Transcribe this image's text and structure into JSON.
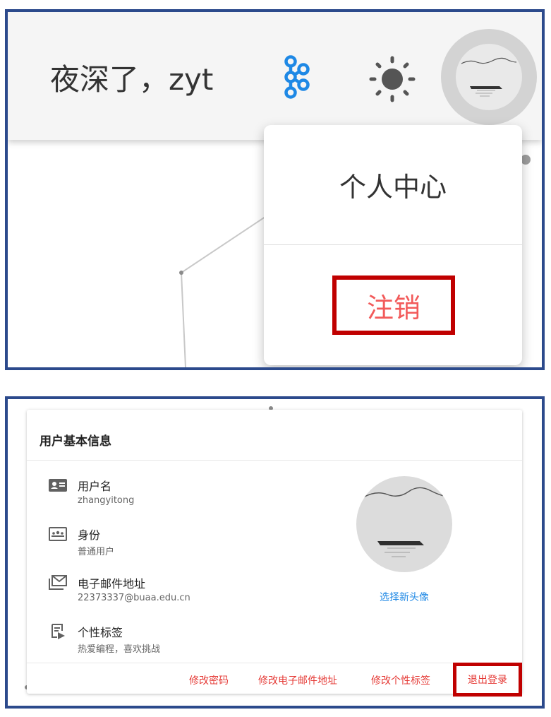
{
  "top": {
    "greeting": "夜深了，zyt",
    "icons": {
      "kafka": "kafka-icon",
      "theme": "sun-icon",
      "avatar": "avatar"
    },
    "menu": {
      "items": [
        {
          "label": "个人中心"
        },
        {
          "label": "注销"
        }
      ]
    },
    "colors": {
      "kafka": "#1e88e5",
      "logout_text": "#f25a5a",
      "highlight": "#c00000"
    }
  },
  "profile": {
    "title": "用户基本信息",
    "fields": [
      {
        "icon": "id-card-icon",
        "label": "用户名",
        "value": "zhangyitong"
      },
      {
        "icon": "identity-icon",
        "label": "身份",
        "value": "普通用户"
      },
      {
        "icon": "email-icon",
        "label": "电子邮件地址",
        "value": "22373337@buaa.edu.cn"
      },
      {
        "icon": "tag-icon",
        "label": "个性标签",
        "value": "热爱编程，喜欢挑战"
      }
    ],
    "avatar_link": "选择新头像",
    "actions": {
      "change_password": "修改密码",
      "change_email": "修改电子邮件地址",
      "change_tag": "修改个性标签",
      "logout": "退出登录"
    },
    "colors": {
      "action": "#e53935",
      "link": "#1e88e5"
    }
  }
}
